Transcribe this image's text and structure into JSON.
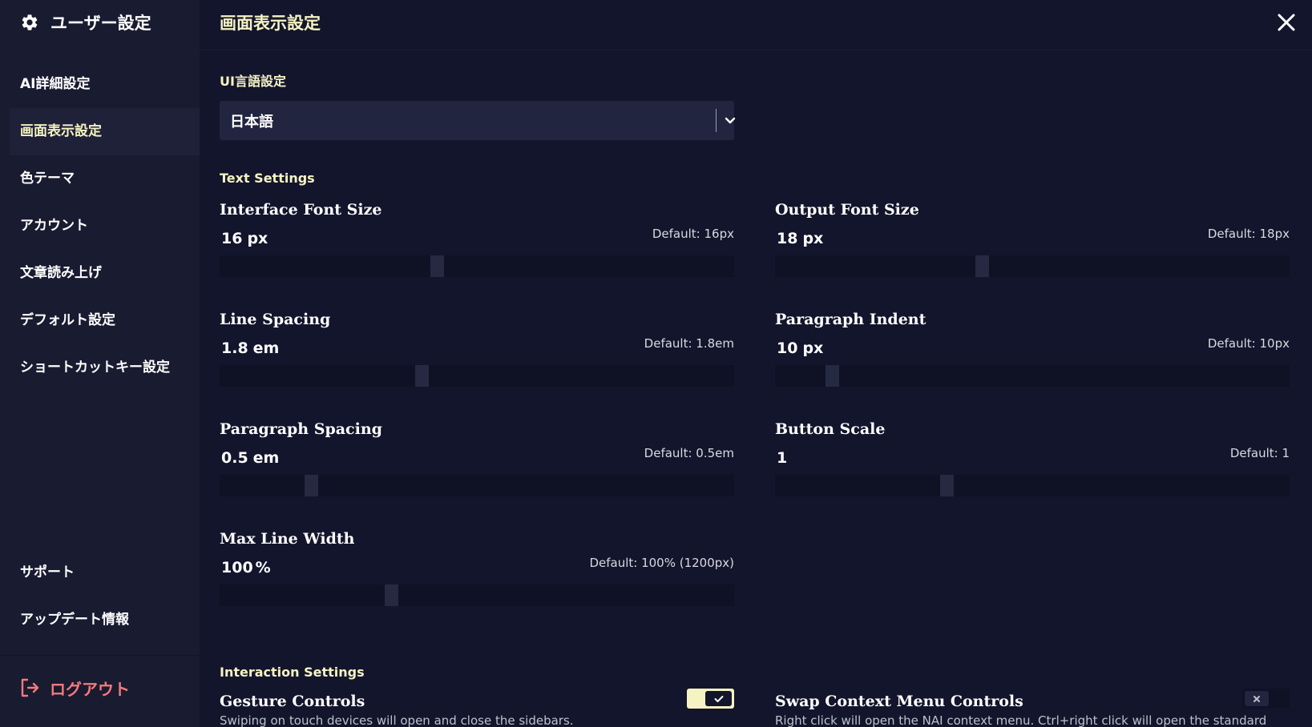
{
  "sidebar": {
    "title": "ユーザー設定",
    "items": [
      {
        "label": "AI詳細設定",
        "active": false
      },
      {
        "label": "画面表示設定",
        "active": true
      },
      {
        "label": "色テーマ",
        "active": false
      },
      {
        "label": "アカウント",
        "active": false
      },
      {
        "label": "文章読み上げ",
        "active": false
      },
      {
        "label": "デフォルト設定",
        "active": false
      },
      {
        "label": "ショートカットキー設定",
        "active": false
      }
    ],
    "bottom_items": [
      {
        "label": "サポート"
      },
      {
        "label": "アップデート情報"
      }
    ],
    "logout_label": "ログアウト"
  },
  "main": {
    "title": "画面表示設定",
    "language": {
      "label": "UI言語設定",
      "value": "日本語"
    },
    "text_settings_label": "Text Settings",
    "settings": [
      {
        "title": "Interface Font Size",
        "value": "16",
        "unit": "px",
        "default": "Default: 16px",
        "fraction": 0.42
      },
      {
        "title": "Output Font Size",
        "value": "18",
        "unit": "px",
        "default": "Default: 18px",
        "fraction": 0.4
      },
      {
        "title": "Line Spacing",
        "value": "1.8",
        "unit": "em",
        "default": "Default: 1.8em",
        "fraction": 0.39
      },
      {
        "title": "Paragraph Indent",
        "value": "10",
        "unit": "px",
        "default": "Default: 10px",
        "fraction": 0.1
      },
      {
        "title": "Paragraph Spacing",
        "value": "0.5",
        "unit": "em",
        "default": "Default: 0.5em",
        "fraction": 0.17
      },
      {
        "title": "Button Scale",
        "value": "1",
        "unit": "",
        "default": "Default: 1",
        "fraction": 0.33
      },
      {
        "title": "Max Line Width",
        "value": "100",
        "unit": "%",
        "default": "Default: 100% (1200px)",
        "fraction": 0.33
      }
    ],
    "interaction_settings_label": "Interaction Settings",
    "toggles": [
      {
        "title": "Gesture Controls",
        "description": "Swiping on touch devices will open and close the sidebars.",
        "on": true
      },
      {
        "title": "Swap Context Menu Controls",
        "description": "Right click will open the NAI context menu. Ctrl+right click will open the standard",
        "on": false
      }
    ]
  },
  "colors": {
    "background": "#13152c",
    "sidebar": "#191b31",
    "accent": "#f5f3c2",
    "logout": "#f57a7a"
  }
}
